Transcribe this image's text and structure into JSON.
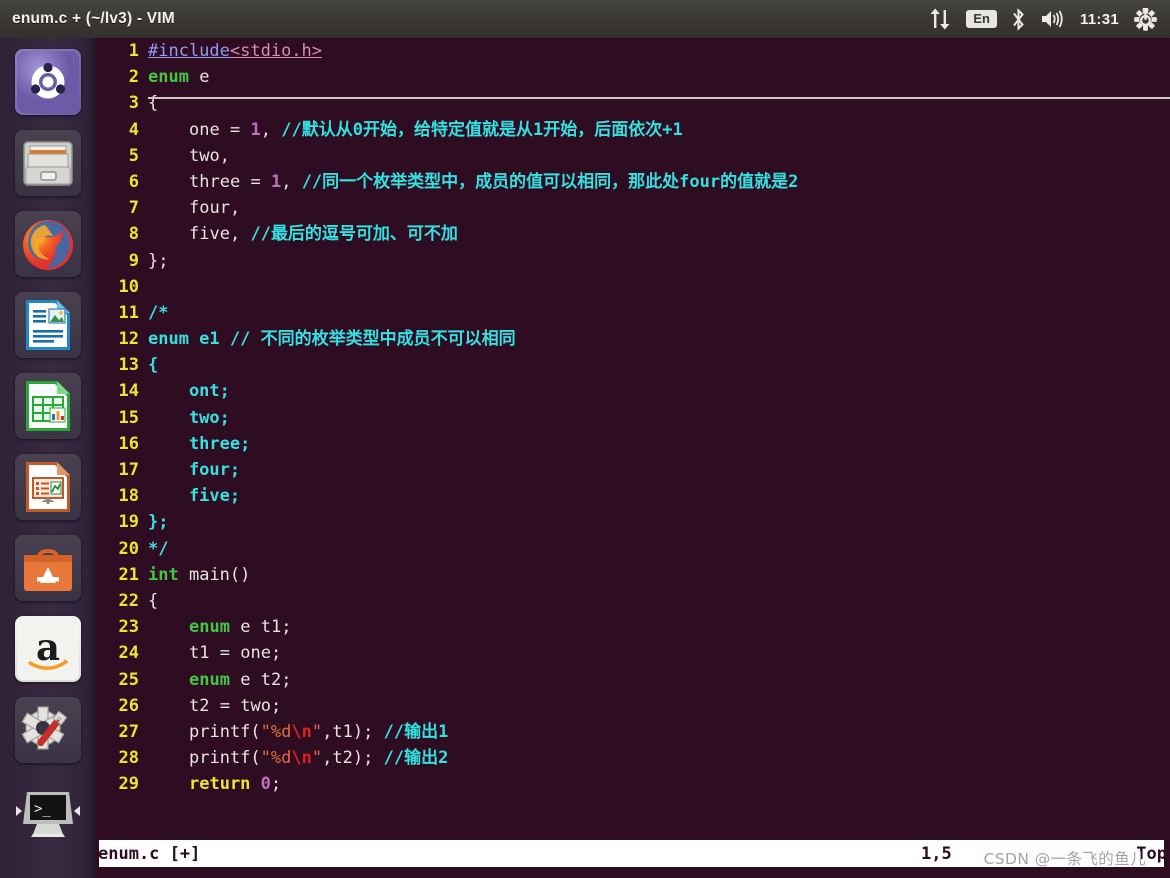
{
  "window": {
    "title": "enum.c + (~/lv3) - VIM"
  },
  "top_panel": {
    "tray": {
      "network_icon": "up-down-arrows-icon",
      "keyboard_layout": "En",
      "bluetooth_icon": "bluetooth-icon",
      "volume_icon": "volume-icon",
      "clock": "11:31",
      "session_icon": "gear-power-icon"
    }
  },
  "launcher": {
    "items": [
      {
        "name": "ubuntu-dash",
        "label": "Ubuntu Dash Home",
        "icon": "ubuntu-logo-icon",
        "running": false
      },
      {
        "name": "files",
        "label": "Files",
        "icon": "file-cabinet-icon",
        "running": false
      },
      {
        "name": "firefox",
        "label": "Firefox Web Browser",
        "icon": "firefox-icon",
        "running": false
      },
      {
        "name": "writer",
        "label": "LibreOffice Writer",
        "icon": "document-icon",
        "running": false
      },
      {
        "name": "calc",
        "label": "LibreOffice Calc",
        "icon": "spreadsheet-icon",
        "running": false
      },
      {
        "name": "impress",
        "label": "LibreOffice Impress",
        "icon": "presentation-icon",
        "running": false
      },
      {
        "name": "software",
        "label": "Ubuntu Software",
        "icon": "software-bag-icon",
        "running": false
      },
      {
        "name": "amazon",
        "label": "Amazon",
        "icon": "amazon-icon",
        "running": false
      },
      {
        "name": "settings",
        "label": "System Settings",
        "icon": "gear-wrench-icon",
        "running": false
      },
      {
        "name": "terminal",
        "label": "Terminal",
        "icon": "terminal-icon",
        "running": true
      }
    ]
  },
  "editor": {
    "filename": "enum.c",
    "lines": [
      {
        "n": "1",
        "text": "#include<stdio.h>"
      },
      {
        "n": "2",
        "text": "enum e"
      },
      {
        "n": "3",
        "text": "{"
      },
      {
        "n": "4",
        "text": "    one = 1, //默认从0开始，给特定值就是从1开始，后面依次+1"
      },
      {
        "n": "5",
        "text": "    two,"
      },
      {
        "n": "6",
        "text": "    three = 1, //同一个枚举类型中，成员的值可以相同，那此处four的值就是2"
      },
      {
        "n": "7",
        "text": "    four,"
      },
      {
        "n": "8",
        "text": "    five, //最后的逗号可加、可不加"
      },
      {
        "n": "9",
        "text": "};"
      },
      {
        "n": "10",
        "text": ""
      },
      {
        "n": "11",
        "text": "/*"
      },
      {
        "n": "12",
        "text": "enum e1 // 不同的枚举类型中成员不可以相同"
      },
      {
        "n": "13",
        "text": "{"
      },
      {
        "n": "14",
        "text": "    ont;"
      },
      {
        "n": "15",
        "text": "    two;"
      },
      {
        "n": "16",
        "text": "    three;"
      },
      {
        "n": "17",
        "text": "    four;"
      },
      {
        "n": "18",
        "text": "    five;"
      },
      {
        "n": "19",
        "text": "};"
      },
      {
        "n": "20",
        "text": "*/"
      },
      {
        "n": "21",
        "text": "int main()"
      },
      {
        "n": "22",
        "text": "{"
      },
      {
        "n": "23",
        "text": "    enum e t1;"
      },
      {
        "n": "24",
        "text": "    t1 = one;"
      },
      {
        "n": "25",
        "text": "    enum e t2;"
      },
      {
        "n": "26",
        "text": "    t2 = two;"
      },
      {
        "n": "27",
        "text": "    printf(\"%d\\n\",t1); //输出1"
      },
      {
        "n": "28",
        "text": "    printf(\"%d\\n\",t2); //输出2"
      },
      {
        "n": "29",
        "text": "    return 0;"
      }
    ]
  },
  "status_bar": {
    "file": "enum.c [+]",
    "position": "1,5",
    "scroll": "Top"
  },
  "watermark": {
    "text": "CSDN @一条飞的鱼儿"
  },
  "colors": {
    "code_background": "#2e0d22",
    "panel_background": "#3b3935",
    "launcher_background": "#372a41",
    "line_number": "#ebe534",
    "comment": "#35e0e0",
    "keyword": "#43c743",
    "string": "#e06c3b",
    "escape": "#e02020",
    "number": "#c06fbd",
    "status_background": "#ffffff"
  }
}
